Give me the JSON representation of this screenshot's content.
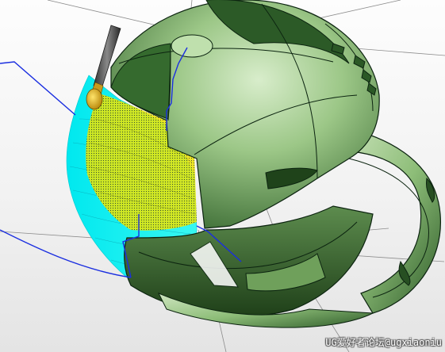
{
  "watermark": {
    "text": "UG爱好者论坛@ugxiaoniu"
  },
  "colors": {
    "background": "#f2f2f2",
    "model_light": "#b9dba8",
    "model_mid": "#7fb06a",
    "model_dark": "#2f5e2a",
    "model_edge": "#0c2410",
    "toolpath_cyan": "#00f0f0",
    "toolpath_yellow": "#f0e800",
    "tool_path_blue": "#1a2ee0",
    "tool_tip": "#d9a000",
    "tool_shank": "#555555",
    "axis_lines": "#888888"
  },
  "icons": {
    "cutting_tool": "ball-end-mill-icon"
  }
}
